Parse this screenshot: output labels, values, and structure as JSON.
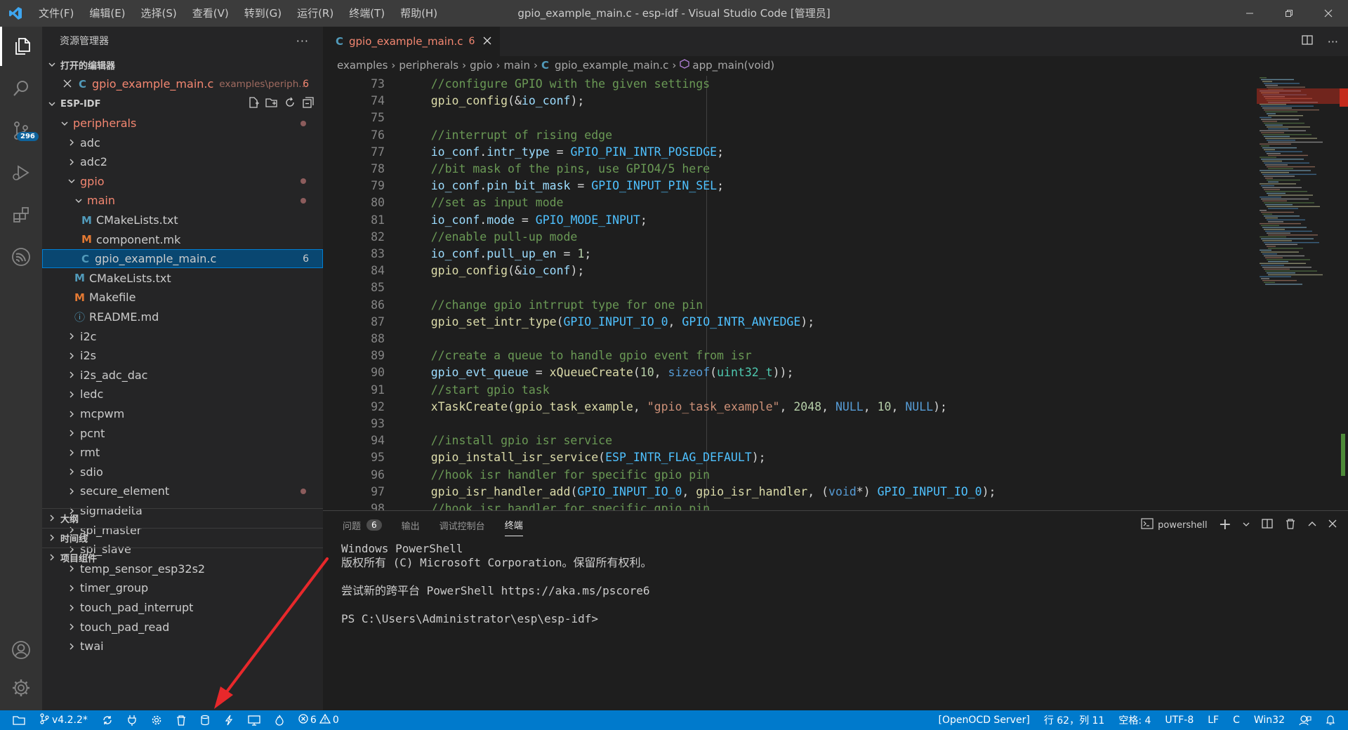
{
  "titlebar": {
    "menu": [
      "文件(F)",
      "编辑(E)",
      "选择(S)",
      "查看(V)",
      "转到(G)",
      "运行(R)",
      "终端(T)",
      "帮助(H)"
    ],
    "title": "gpio_example_main.c - esp-idf - Visual Studio Code [管理员]"
  },
  "activity": {
    "scm_badge": "296"
  },
  "sidebar": {
    "title": "资源管理器",
    "more": "···",
    "open_editors": "打开的编辑器",
    "open_file": {
      "name": "gpio_example_main.c",
      "path": "examples\\periph...",
      "count": "6"
    },
    "root": "ESP-IDF",
    "tree": [
      {
        "label": "peripherals",
        "indent": 0,
        "kind": "folder-open",
        "color": "#f48771",
        "dot": true
      },
      {
        "label": "adc",
        "indent": 1,
        "kind": "folder"
      },
      {
        "label": "adc2",
        "indent": 1,
        "kind": "folder"
      },
      {
        "label": "gpio",
        "indent": 1,
        "kind": "folder-open",
        "color": "#f48771",
        "dot": true
      },
      {
        "label": "main",
        "indent": 2,
        "kind": "folder-open",
        "color": "#f48771",
        "dot": true
      },
      {
        "label": "CMakeLists.txt",
        "indent": 3,
        "kind": "cmake"
      },
      {
        "label": "component.mk",
        "indent": 3,
        "kind": "make"
      },
      {
        "label": "gpio_example_main.c",
        "indent": 3,
        "kind": "c",
        "selected": true,
        "count": "6"
      },
      {
        "label": "CMakeLists.txt",
        "indent": 2,
        "kind": "cmake"
      },
      {
        "label": "Makefile",
        "indent": 2,
        "kind": "make"
      },
      {
        "label": "README.md",
        "indent": 2,
        "kind": "info"
      },
      {
        "label": "i2c",
        "indent": 1,
        "kind": "folder"
      },
      {
        "label": "i2s",
        "indent": 1,
        "kind": "folder"
      },
      {
        "label": "i2s_adc_dac",
        "indent": 1,
        "kind": "folder"
      },
      {
        "label": "ledc",
        "indent": 1,
        "kind": "folder"
      },
      {
        "label": "mcpwm",
        "indent": 1,
        "kind": "folder"
      },
      {
        "label": "pcnt",
        "indent": 1,
        "kind": "folder"
      },
      {
        "label": "rmt",
        "indent": 1,
        "kind": "folder"
      },
      {
        "label": "sdio",
        "indent": 1,
        "kind": "folder"
      },
      {
        "label": "secure_element",
        "indent": 1,
        "kind": "folder",
        "dot": true
      },
      {
        "label": "sigmadelta",
        "indent": 1,
        "kind": "folder"
      },
      {
        "label": "spi_master",
        "indent": 1,
        "kind": "folder"
      },
      {
        "label": "spi_slave",
        "indent": 1,
        "kind": "folder"
      },
      {
        "label": "temp_sensor_esp32s2",
        "indent": 1,
        "kind": "folder"
      },
      {
        "label": "timer_group",
        "indent": 1,
        "kind": "folder"
      },
      {
        "label": "touch_pad_interrupt",
        "indent": 1,
        "kind": "folder"
      },
      {
        "label": "touch_pad_read",
        "indent": 1,
        "kind": "folder"
      },
      {
        "label": "twai",
        "indent": 1,
        "kind": "folder"
      }
    ],
    "outline": "大纲",
    "timeline": "时间线",
    "project": "项目组件"
  },
  "editor": {
    "tab": {
      "name": "gpio_example_main.c",
      "count": "6"
    },
    "breadcrumb": [
      "examples",
      "peripherals",
      "gpio",
      "main",
      "gpio_example_main.c",
      "app_main(void)"
    ],
    "lines": [
      {
        "n": "73",
        "t": [
          [
            "cm",
            "//configure GPIO with the given settings"
          ]
        ]
      },
      {
        "n": "74",
        "t": [
          [
            "fn",
            "gpio_config"
          ],
          [
            "pl",
            "(&"
          ],
          [
            "vr",
            "io_conf"
          ],
          [
            "pl",
            ");"
          ]
        ]
      },
      {
        "n": "75",
        "t": []
      },
      {
        "n": "76",
        "t": [
          [
            "cm",
            "//interrupt of rising edge"
          ]
        ]
      },
      {
        "n": "77",
        "t": [
          [
            "vr",
            "io_conf"
          ],
          [
            "pl",
            "."
          ],
          [
            "vr",
            "intr_type"
          ],
          [
            "pl",
            " = "
          ],
          [
            "cn",
            "GPIO_PIN_INTR_POSEDGE"
          ],
          [
            "pl",
            ";"
          ]
        ]
      },
      {
        "n": "78",
        "t": [
          [
            "cm",
            "//bit mask of the pins, use GPIO4/5 here"
          ]
        ]
      },
      {
        "n": "79",
        "t": [
          [
            "vr",
            "io_conf"
          ],
          [
            "pl",
            "."
          ],
          [
            "vr",
            "pin_bit_mask"
          ],
          [
            "pl",
            " = "
          ],
          [
            "cn",
            "GPIO_INPUT_PIN_SEL"
          ],
          [
            "pl",
            ";"
          ]
        ]
      },
      {
        "n": "80",
        "t": [
          [
            "cm",
            "//set as input mode"
          ]
        ]
      },
      {
        "n": "81",
        "t": [
          [
            "vr",
            "io_conf"
          ],
          [
            "pl",
            "."
          ],
          [
            "vr",
            "mode"
          ],
          [
            "pl",
            " = "
          ],
          [
            "cn",
            "GPIO_MODE_INPUT"
          ],
          [
            "pl",
            ";"
          ]
        ]
      },
      {
        "n": "82",
        "t": [
          [
            "cm",
            "//enable pull-up mode"
          ]
        ]
      },
      {
        "n": "83",
        "t": [
          [
            "vr",
            "io_conf"
          ],
          [
            "pl",
            "."
          ],
          [
            "vr",
            "pull_up_en"
          ],
          [
            "pl",
            " = "
          ],
          [
            "nm",
            "1"
          ],
          [
            "pl",
            ";"
          ]
        ]
      },
      {
        "n": "84",
        "t": [
          [
            "fn",
            "gpio_config"
          ],
          [
            "pl",
            "(&"
          ],
          [
            "vr",
            "io_conf"
          ],
          [
            "pl",
            ");"
          ]
        ]
      },
      {
        "n": "85",
        "t": []
      },
      {
        "n": "86",
        "t": [
          [
            "cm",
            "//change gpio intrrupt type for one pin"
          ]
        ]
      },
      {
        "n": "87",
        "t": [
          [
            "fn",
            "gpio_set_intr_type"
          ],
          [
            "pl",
            "("
          ],
          [
            "cn",
            "GPIO_INPUT_IO_0"
          ],
          [
            "pl",
            ", "
          ],
          [
            "cn",
            "GPIO_INTR_ANYEDGE"
          ],
          [
            "pl",
            ");"
          ]
        ]
      },
      {
        "n": "88",
        "t": []
      },
      {
        "n": "89",
        "t": [
          [
            "cm",
            "//create a queue to handle gpio event from isr"
          ]
        ]
      },
      {
        "n": "90",
        "t": [
          [
            "vr",
            "gpio_evt_queue"
          ],
          [
            "pl",
            " = "
          ],
          [
            "fn",
            "xQueueCreate"
          ],
          [
            "pl",
            "("
          ],
          [
            "nm",
            "10"
          ],
          [
            "pl",
            ", "
          ],
          [
            "kw",
            "sizeof"
          ],
          [
            "pl",
            "("
          ],
          [
            "ty",
            "uint32_t"
          ],
          [
            "pl",
            "));"
          ]
        ]
      },
      {
        "n": "91",
        "t": [
          [
            "cm",
            "//start gpio task"
          ]
        ]
      },
      {
        "n": "92",
        "t": [
          [
            "fn",
            "xTaskCreate"
          ],
          [
            "pl",
            "("
          ],
          [
            "fn",
            "gpio_task_example"
          ],
          [
            "pl",
            ", "
          ],
          [
            "st",
            "\"gpio_task_example\""
          ],
          [
            "pl",
            ", "
          ],
          [
            "nm",
            "2048"
          ],
          [
            "pl",
            ", "
          ],
          [
            "kw",
            "NULL"
          ],
          [
            "pl",
            ", "
          ],
          [
            "nm",
            "10"
          ],
          [
            "pl",
            ", "
          ],
          [
            "kw",
            "NULL"
          ],
          [
            "pl",
            ");"
          ]
        ]
      },
      {
        "n": "93",
        "t": []
      },
      {
        "n": "94",
        "t": [
          [
            "cm",
            "//install gpio isr service"
          ]
        ]
      },
      {
        "n": "95",
        "t": [
          [
            "fn",
            "gpio_install_isr_service"
          ],
          [
            "pl",
            "("
          ],
          [
            "cn",
            "ESP_INTR_FLAG_DEFAULT"
          ],
          [
            "pl",
            ");"
          ]
        ]
      },
      {
        "n": "96",
        "t": [
          [
            "cm",
            "//hook isr handler for specific gpio pin"
          ]
        ]
      },
      {
        "n": "97",
        "t": [
          [
            "fn",
            "gpio_isr_handler_add"
          ],
          [
            "pl",
            "("
          ],
          [
            "cn",
            "GPIO_INPUT_IO_0"
          ],
          [
            "pl",
            ", "
          ],
          [
            "fn",
            "gpio_isr_handler"
          ],
          [
            "pl",
            ", ("
          ],
          [
            "kw",
            "void"
          ],
          [
            "pl",
            "*) "
          ],
          [
            "cn",
            "GPIO_INPUT_IO_0"
          ],
          [
            "pl",
            ");"
          ]
        ]
      },
      {
        "n": "98",
        "t": [
          [
            "cm",
            "//hook isr handler for specific gpio pin"
          ]
        ]
      }
    ]
  },
  "panel": {
    "tabs": [
      "问题",
      "输出",
      "调试控制台",
      "终端"
    ],
    "problems_count": "6",
    "shell": "powershell",
    "terminal": [
      "Windows PowerShell",
      "版权所有 (C) Microsoft Corporation。保留所有权利。",
      "",
      "尝试新的跨平台 PowerShell https://aka.ms/pscore6",
      "",
      "PS C:\\Users\\Administrator\\esp\\esp-idf>"
    ]
  },
  "statusbar": {
    "version": "v4.2.2*",
    "errors": "6",
    "warnings": "0",
    "openocd": "[OpenOCD Server]",
    "position": "行 62，列 11",
    "spaces": "空格: 4",
    "encoding": "UTF-8",
    "eol": "LF",
    "language": "C",
    "target": "Win32"
  },
  "colors": {
    "accent": "#007acc",
    "selection": "#094771",
    "error": "#f48771",
    "annotation": "#e8282b"
  }
}
